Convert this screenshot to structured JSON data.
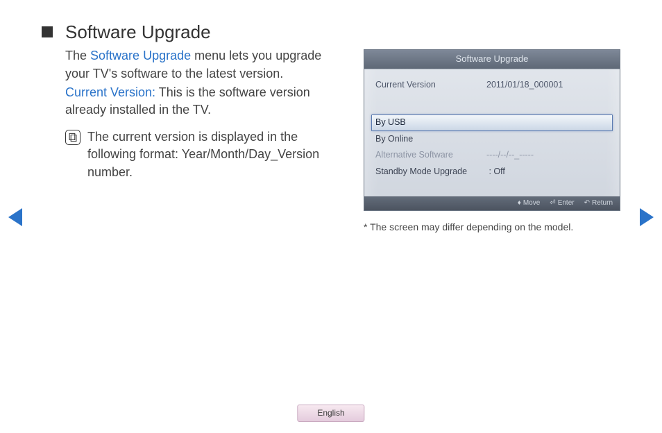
{
  "heading": "Software Upgrade",
  "intro_prefix": "The ",
  "intro_link": "Software Upgrade",
  "intro_suffix": " menu lets you upgrade your TV's software to the latest version.",
  "cv_label": "Current Version:",
  "cv_text": " This is the software version already installed in the TV.",
  "note": "The current version is displayed in the following format: Year/Month/Day_Version number.",
  "tv": {
    "title": "Software Upgrade",
    "current_version_label": "Current Version",
    "current_version_value": "2011/01/18_000001",
    "by_usb": "By USB",
    "by_online": "By Online",
    "alt_label": "Alternative Software",
    "alt_value": "----/--/--_-----",
    "standby_label": "Standby Mode Upgrade",
    "standby_value": ": Off",
    "footer_move": "Move",
    "footer_enter": "Enter",
    "footer_return": "Return"
  },
  "screen_note_prefix": "* ",
  "screen_note": "The screen may differ depending on the model.",
  "language": "English"
}
